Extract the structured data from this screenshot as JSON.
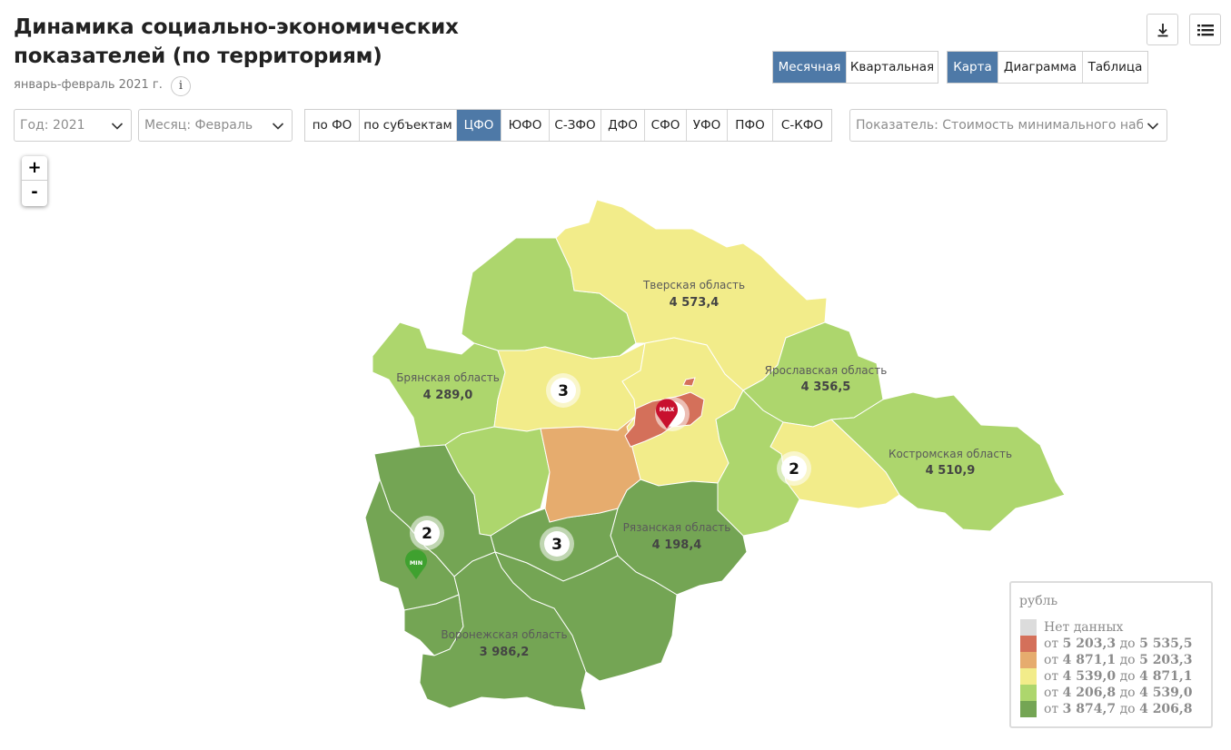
{
  "header": {
    "title": "Динамика социально-экономических показателей (по территориям)",
    "period": "январь-февраль 2021 г.",
    "info_icon": "i"
  },
  "toolbar": {
    "download_icon": "download-icon",
    "menu_icon": "menu-list-icon"
  },
  "periodicity": {
    "options": [
      "Месячная",
      "Квартальная"
    ],
    "selected": "Месячная"
  },
  "view_mode": {
    "options": [
      "Карта",
      "Диаграмма",
      "Таблица"
    ],
    "selected": "Карта"
  },
  "filters": {
    "year": "Год: 2021",
    "month": "Месяц: Февраль",
    "indicator": "Показатель: Стоимость минимального набор"
  },
  "districts": {
    "options": [
      "по ФО",
      "по субъектам",
      "ЦФО",
      "ЮФО",
      "С-ЗФО",
      "ДФО",
      "СФО",
      "УФО",
      "ПФО",
      "С-КФО"
    ],
    "selected": "ЦФО"
  },
  "zoom": {
    "in": "+",
    "out": "-"
  },
  "map": {
    "labeled_regions": [
      {
        "name": "Тверская область",
        "value": "4 573,4"
      },
      {
        "name": "Брянская область",
        "value": "4 289,0"
      },
      {
        "name": "Ярославская область",
        "value": "4 356,5"
      },
      {
        "name": "Костромская область",
        "value": "4 510,9"
      },
      {
        "name": "Рязанская область",
        "value": "4 198,4"
      },
      {
        "name": "Воронежская область",
        "value": "3 986,2"
      }
    ],
    "clusters": [
      "3",
      "2",
      "3",
      "2"
    ],
    "max_marker": "MAX",
    "min_marker": "MIN",
    "max_cluster": "-"
  },
  "legend": {
    "unit": "рубль",
    "no_data": "Нет данных",
    "word_from": "от",
    "word_to": "до",
    "bins": [
      {
        "from": "5 203,3",
        "to": "5 535,5",
        "color": "#d4705a"
      },
      {
        "from": "4 871,1",
        "to": "5 203,3",
        "color": "#e6ac6e"
      },
      {
        "from": "4 539,0",
        "to": "4 871,1",
        "color": "#f2ec8a"
      },
      {
        "from": "4 206,8",
        "to": "4 539,0",
        "color": "#add66d"
      },
      {
        "from": "3 874,7",
        "to": "4 206,8",
        "color": "#74a554"
      }
    ],
    "no_data_color": "#dcdcdc"
  }
}
